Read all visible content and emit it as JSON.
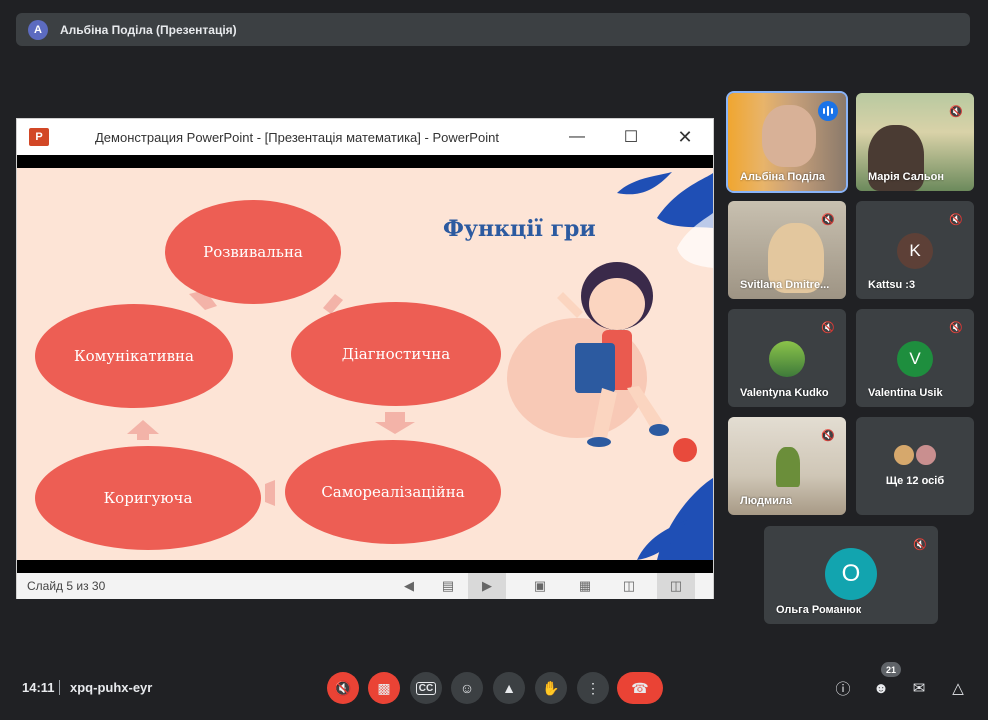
{
  "header": {
    "presenter_initial": "A",
    "presenter_title": "Альбіна Поділа (Презентація)"
  },
  "presentation": {
    "app_logo": "P",
    "window_title": "Демонстрация PowerPoint - [Презентація математика] - PowerPoint",
    "minimize_icon": "minimize-icon",
    "maximize_icon": "maximize-icon",
    "close_icon": "close-icon",
    "slide": {
      "title": "Функції гри",
      "nodes": [
        "Розвивальна",
        "Комунікативна",
        "Діагностична",
        "Коригуюча",
        "Самореалізаційна"
      ]
    },
    "status": "Слайд 5 из 30"
  },
  "participants": [
    {
      "name": "Альбіна Поділа",
      "speaking": true
    },
    {
      "name": "Марія Сальон",
      "muted": true
    },
    {
      "name": "Svitlana Dmitre...",
      "muted": true
    },
    {
      "name": "Kattsu :3",
      "initial": "K",
      "color": "#5d4037",
      "muted": true
    },
    {
      "name": "Valentyna Kudko",
      "muted": true
    },
    {
      "name": "Valentina Usik",
      "initial": "V",
      "color": "#1e8e3e",
      "muted": true
    },
    {
      "name": "Людмила",
      "muted": true
    },
    {
      "name": "Ще 12 осіб"
    },
    {
      "name": "Ольга Романюк",
      "initial": "O",
      "color": "#12a4af",
      "muted": true
    }
  ],
  "footer": {
    "time": "14:11",
    "meeting_code": "xpq-puhx-eyr",
    "people_count": "21"
  },
  "colors": {
    "background": "#202124",
    "tile": "#3c4043",
    "danger": "#ea4335",
    "accent": "#1a73e8"
  }
}
